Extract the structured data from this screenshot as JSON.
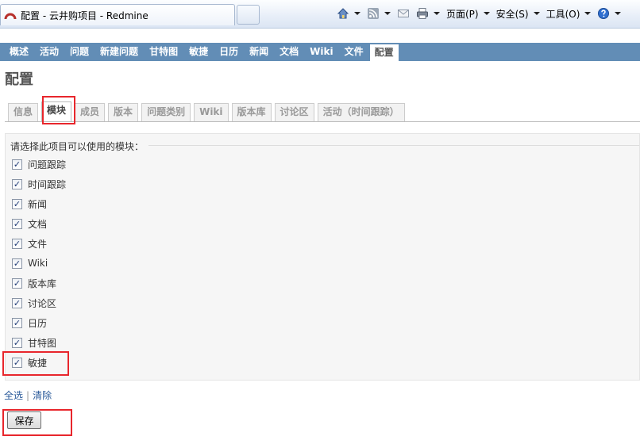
{
  "browser": {
    "tab_title": "配置 - 云井购项目 - Redmine",
    "toolbar": {
      "page_menu": "页面(P)",
      "safety_menu": "安全(S)",
      "tools_menu": "工具(O)"
    }
  },
  "main_menu": {
    "items": [
      {
        "label": "概述"
      },
      {
        "label": "活动"
      },
      {
        "label": "问题"
      },
      {
        "label": "新建问题"
      },
      {
        "label": "甘特图"
      },
      {
        "label": "敏捷"
      },
      {
        "label": "日历"
      },
      {
        "label": "新闻"
      },
      {
        "label": "文档"
      },
      {
        "label": "Wiki"
      },
      {
        "label": "文件"
      },
      {
        "label": "配置"
      }
    ]
  },
  "page_title": "配置",
  "settings_tabs": [
    {
      "label": "信息"
    },
    {
      "label": "模块"
    },
    {
      "label": "成员"
    },
    {
      "label": "版本"
    },
    {
      "label": "问题类别"
    },
    {
      "label": "Wiki"
    },
    {
      "label": "版本库"
    },
    {
      "label": "讨论区"
    },
    {
      "label": "活动（时间跟踪）"
    }
  ],
  "modules": {
    "legend": "请选择此项目可以使用的模块：",
    "items": [
      {
        "label": "问题跟踪",
        "checked": true
      },
      {
        "label": "时间跟踪",
        "checked": true
      },
      {
        "label": "新闻",
        "checked": true
      },
      {
        "label": "文档",
        "checked": true
      },
      {
        "label": "文件",
        "checked": true
      },
      {
        "label": "Wiki",
        "checked": true
      },
      {
        "label": "版本库",
        "checked": true
      },
      {
        "label": "讨论区",
        "checked": true
      },
      {
        "label": "日历",
        "checked": true
      },
      {
        "label": "甘特图",
        "checked": true
      },
      {
        "label": "敏捷",
        "checked": true
      }
    ]
  },
  "links": {
    "select_all": "全选",
    "separator": "|",
    "clear": "清除"
  },
  "save_label": "保存",
  "colors": {
    "menu_bg": "#628db6",
    "highlight": "#e8262c"
  }
}
